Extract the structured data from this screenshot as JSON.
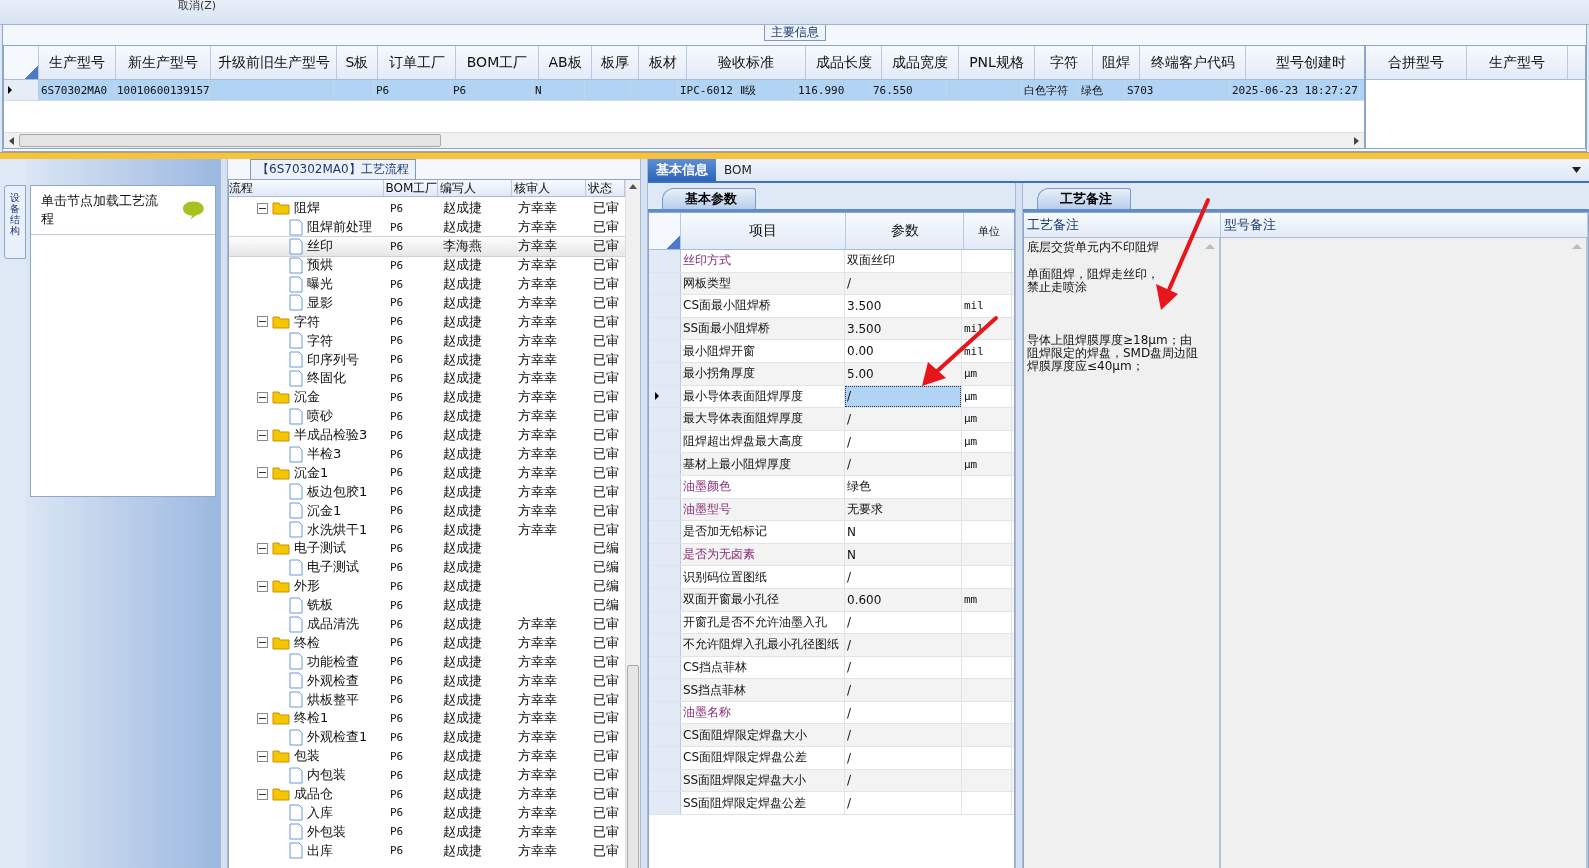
{
  "toolbar": {
    "cut_label": "取消(Z)"
  },
  "main_info": {
    "title": "主要信息",
    "columns": [
      "生产型号",
      "新生产型号",
      "升级前旧生产型号",
      "S板",
      "订单工厂",
      "BOM工厂",
      "AB板",
      "板厚",
      "板材",
      "验收标准",
      "成品长度",
      "成品宽度",
      "PNL规格",
      "字符",
      "阻焊",
      "终端客户代码",
      "型号创建时"
    ],
    "rows": [
      {
        "selected": true,
        "cells": [
          "6S70302MA0",
          "10010600139157",
          null,
          null,
          "P6",
          "P6",
          "N",
          null,
          null,
          "IPC-6012 Ⅱ级",
          "116.990",
          "76.550",
          null,
          "白色字符",
          "绿色",
          "S703",
          "2025-06-23 18:27:27"
        ]
      }
    ]
  },
  "merge_grid": {
    "columns": [
      "合拼型号",
      "生产型号"
    ]
  },
  "side_tab": {
    "label": "设备结构"
  },
  "side_panel": {
    "hint": "单击节点加载工艺流程"
  },
  "flow": {
    "title": "【6S70302MA0】工艺流程",
    "columns": [
      "流程",
      "BOM工厂",
      "编写人",
      "核审人",
      "状态"
    ],
    "items": [
      {
        "name": "阻焊",
        "factory": "P6",
        "writer": "赵成捷",
        "reviewer": "方幸幸",
        "status": "已审",
        "selected": false,
        "expanded": true,
        "children": [
          {
            "name": "阻焊前处理",
            "factory": "P6",
            "writer": "赵成捷",
            "reviewer": "方幸幸",
            "status": "已审",
            "selected": false
          },
          {
            "name": "丝印",
            "factory": "P6",
            "writer": "李海燕",
            "reviewer": "方幸幸",
            "status": "已审",
            "selected": true
          },
          {
            "name": "预烘",
            "factory": "P6",
            "writer": "赵成捷",
            "reviewer": "方幸幸",
            "status": "已审",
            "selected": false
          },
          {
            "name": "曝光",
            "factory": "P6",
            "writer": "赵成捷",
            "reviewer": "方幸幸",
            "status": "已审",
            "selected": false
          },
          {
            "name": "显影",
            "factory": "P6",
            "writer": "赵成捷",
            "reviewer": "方幸幸",
            "status": "已审",
            "selected": false
          }
        ]
      },
      {
        "name": "字符",
        "factory": "P6",
        "writer": "赵成捷",
        "reviewer": "方幸幸",
        "status": "已审",
        "selected": false,
        "expanded": true,
        "children": [
          {
            "name": "字符",
            "factory": "P6",
            "writer": "赵成捷",
            "reviewer": "方幸幸",
            "status": "已审",
            "selected": false
          },
          {
            "name": "印序列号",
            "factory": "P6",
            "writer": "赵成捷",
            "reviewer": "方幸幸",
            "status": "已审",
            "selected": false
          },
          {
            "name": "终固化",
            "factory": "P6",
            "writer": "赵成捷",
            "reviewer": "方幸幸",
            "status": "已审",
            "selected": false
          }
        ]
      },
      {
        "name": "沉金",
        "factory": "P6",
        "writer": "赵成捷",
        "reviewer": "方幸幸",
        "status": "已审",
        "selected": false,
        "expanded": true,
        "children": [
          {
            "name": "喷砂",
            "factory": "P6",
            "writer": "赵成捷",
            "reviewer": "方幸幸",
            "status": "已审",
            "selected": false
          }
        ]
      },
      {
        "name": "半成品检验3",
        "factory": "P6",
        "writer": "赵成捷",
        "reviewer": "方幸幸",
        "status": "已审",
        "selected": false,
        "expanded": true,
        "children": [
          {
            "name": "半检3",
            "factory": "P6",
            "writer": "赵成捷",
            "reviewer": "方幸幸",
            "status": "已审",
            "selected": false
          }
        ]
      },
      {
        "name": "沉金1",
        "factory": "P6",
        "writer": "赵成捷",
        "reviewer": "方幸幸",
        "status": "已审",
        "selected": false,
        "expanded": true,
        "children": [
          {
            "name": "板边包胶1",
            "factory": "P6",
            "writer": "赵成捷",
            "reviewer": "方幸幸",
            "status": "已审",
            "selected": false
          },
          {
            "name": "沉金1",
            "factory": "P6",
            "writer": "赵成捷",
            "reviewer": "方幸幸",
            "status": "已审",
            "selected": false
          },
          {
            "name": "水洗烘干1",
            "factory": "P6",
            "writer": "赵成捷",
            "reviewer": "方幸幸",
            "status": "已审",
            "selected": false
          }
        ]
      },
      {
        "name": "电子测试",
        "factory": "P6",
        "writer": "赵成捷",
        "status": "已编",
        "selected": false,
        "expanded": true,
        "children": [
          {
            "name": "电子测试",
            "factory": "P6",
            "writer": "赵成捷",
            "status": "已编",
            "selected": false
          }
        ]
      },
      {
        "name": "外形",
        "factory": "P6",
        "writer": "赵成捷",
        "status": "已编",
        "selected": false,
        "expanded": true,
        "children": [
          {
            "name": "铣板",
            "factory": "P6",
            "writer": "赵成捷",
            "status": "已编",
            "selected": false
          },
          {
            "name": "成品清洗",
            "factory": "P6",
            "writer": "赵成捷",
            "reviewer": "方幸幸",
            "status": "已审",
            "selected": false
          }
        ]
      },
      {
        "name": "终检",
        "factory": "P6",
        "writer": "赵成捷",
        "reviewer": "方幸幸",
        "status": "已审",
        "selected": false,
        "expanded": true,
        "children": [
          {
            "name": "功能检查",
            "factory": "P6",
            "writer": "赵成捷",
            "reviewer": "方幸幸",
            "status": "已审",
            "selected": false
          },
          {
            "name": "外观检查",
            "factory": "P6",
            "writer": "赵成捷",
            "reviewer": "方幸幸",
            "status": "已审",
            "selected": false
          },
          {
            "name": "烘板整平",
            "factory": "P6",
            "writer": "赵成捷",
            "reviewer": "方幸幸",
            "status": "已审",
            "selected": false
          }
        ]
      },
      {
        "name": "终检1",
        "factory": "P6",
        "writer": "赵成捷",
        "reviewer": "方幸幸",
        "status": "已审",
        "selected": false,
        "expanded": true,
        "children": [
          {
            "name": "外观检查1",
            "factory": "P6",
            "writer": "赵成捷",
            "reviewer": "方幸幸",
            "status": "已审",
            "selected": false
          }
        ]
      },
      {
        "name": "包装",
        "factory": "P6",
        "writer": "赵成捷",
        "reviewer": "方幸幸",
        "status": "已审",
        "selected": false,
        "expanded": true,
        "children": [
          {
            "name": "内包装",
            "factory": "P6",
            "writer": "赵成捷",
            "reviewer": "方幸幸",
            "status": "已审",
            "selected": false
          }
        ]
      },
      {
        "name": "成品仓",
        "factory": "P6",
        "writer": "赵成捷",
        "reviewer": "方幸幸",
        "status": "已审",
        "selected": false,
        "expanded": true,
        "children": [
          {
            "name": "入库",
            "factory": "P6",
            "writer": "赵成捷",
            "reviewer": "方幸幸",
            "status": "已审",
            "selected": false
          },
          {
            "name": "外包装",
            "factory": "P6",
            "writer": "赵成捷",
            "reviewer": "方幸幸",
            "status": "已审",
            "selected": false
          },
          {
            "name": "出库",
            "factory": "P6",
            "writer": "赵成捷",
            "reviewer": "方幸幸",
            "status": "已审",
            "selected": false
          }
        ]
      }
    ]
  },
  "detail_tabs": [
    {
      "label": "基本信息",
      "selected": true
    },
    {
      "label": "BOM",
      "selected": false
    }
  ],
  "params": {
    "tab": "基本参数",
    "columns": [
      "项目",
      "参数",
      "单位"
    ],
    "rows": [
      {
        "item": "丝印方式",
        "value": "双面丝印",
        "highlighted": true,
        "selected": false
      },
      {
        "item": "网板类型",
        "value": "/",
        "highlighted": false,
        "selected": false
      },
      {
        "item": "CS面最小阻焊桥",
        "value": "3.500",
        "unit": "mil",
        "highlighted": false,
        "selected": false
      },
      {
        "item": "SS面最小阻焊桥",
        "value": "3.500",
        "unit": "mil",
        "highlighted": false,
        "selected": false
      },
      {
        "item": "最小阻焊开窗",
        "value": "0.00",
        "unit": "mil",
        "highlighted": false,
        "selected": false
      },
      {
        "item": "最小拐角厚度",
        "value": "5.00",
        "unit": "μm",
        "highlighted": false,
        "selected": false
      },
      {
        "item": "最小导体表面阻焊厚度",
        "value": "/",
        "unit": "μm",
        "highlighted": false,
        "selected": true
      },
      {
        "item": "最大导体表面阻焊厚度",
        "value": "/",
        "unit": "μm",
        "highlighted": false,
        "selected": false
      },
      {
        "item": "阻焊超出焊盘最大高度",
        "value": "/",
        "unit": "μm",
        "highlighted": false,
        "selected": false
      },
      {
        "item": "基材上最小阻焊厚度",
        "value": "/",
        "unit": "μm",
        "highlighted": false,
        "selected": false
      },
      {
        "item": "油墨颜色",
        "value": "绿色",
        "highlighted": true,
        "selected": false
      },
      {
        "item": "油墨型号",
        "value": "无要求",
        "highlighted": true,
        "selected": false
      },
      {
        "item": "是否加无铅标记",
        "value": "N",
        "highlighted": false,
        "selected": false
      },
      {
        "item": "是否为无卤素",
        "value": "N",
        "highlighted": true,
        "selected": false
      },
      {
        "item": "识别码位置图纸",
        "value": "/",
        "highlighted": false,
        "selected": false
      },
      {
        "item": "双面开窗最小孔径",
        "value": "0.600",
        "unit": "mm",
        "highlighted": false,
        "selected": false
      },
      {
        "item": "开窗孔是否不允许油墨入孔",
        "value": "/",
        "highlighted": false,
        "selected": false
      },
      {
        "item": "不允许阻焊入孔最小孔径图纸",
        "value": "/",
        "highlighted": false,
        "selected": false
      },
      {
        "item": "CS挡点菲林",
        "value": "/",
        "highlighted": false,
        "selected": false
      },
      {
        "item": "SS挡点菲林",
        "value": "/",
        "highlighted": false,
        "selected": false
      },
      {
        "item": "油墨名称",
        "value": "/",
        "highlighted": true,
        "selected": false
      },
      {
        "item": "CS面阻焊限定焊盘大小",
        "value": "/",
        "highlighted": false,
        "selected": false
      },
      {
        "item": "CS面阻焊限定焊盘公差",
        "value": "/",
        "highlighted": false,
        "selected": false
      },
      {
        "item": "SS面阻焊限定焊盘大小",
        "value": "/",
        "highlighted": false,
        "selected": false
      },
      {
        "item": "SS面阻焊限定焊盘公差",
        "value": "/",
        "highlighted": false,
        "selected": false
      }
    ]
  },
  "notes": {
    "tab": "工艺备注",
    "columns": [
      "工艺备注",
      "型号备注"
    ],
    "paragraphs": [
      "底层交货单元内不印阻焊",
      "单面阻焊，阻焊走丝印，禁止走喷涂",
      "导体上阻焊膜厚度≥18μm；由阻焊限定的焊盘，SMD盘周边阻焊膜厚度应≤40μm；"
    ]
  }
}
